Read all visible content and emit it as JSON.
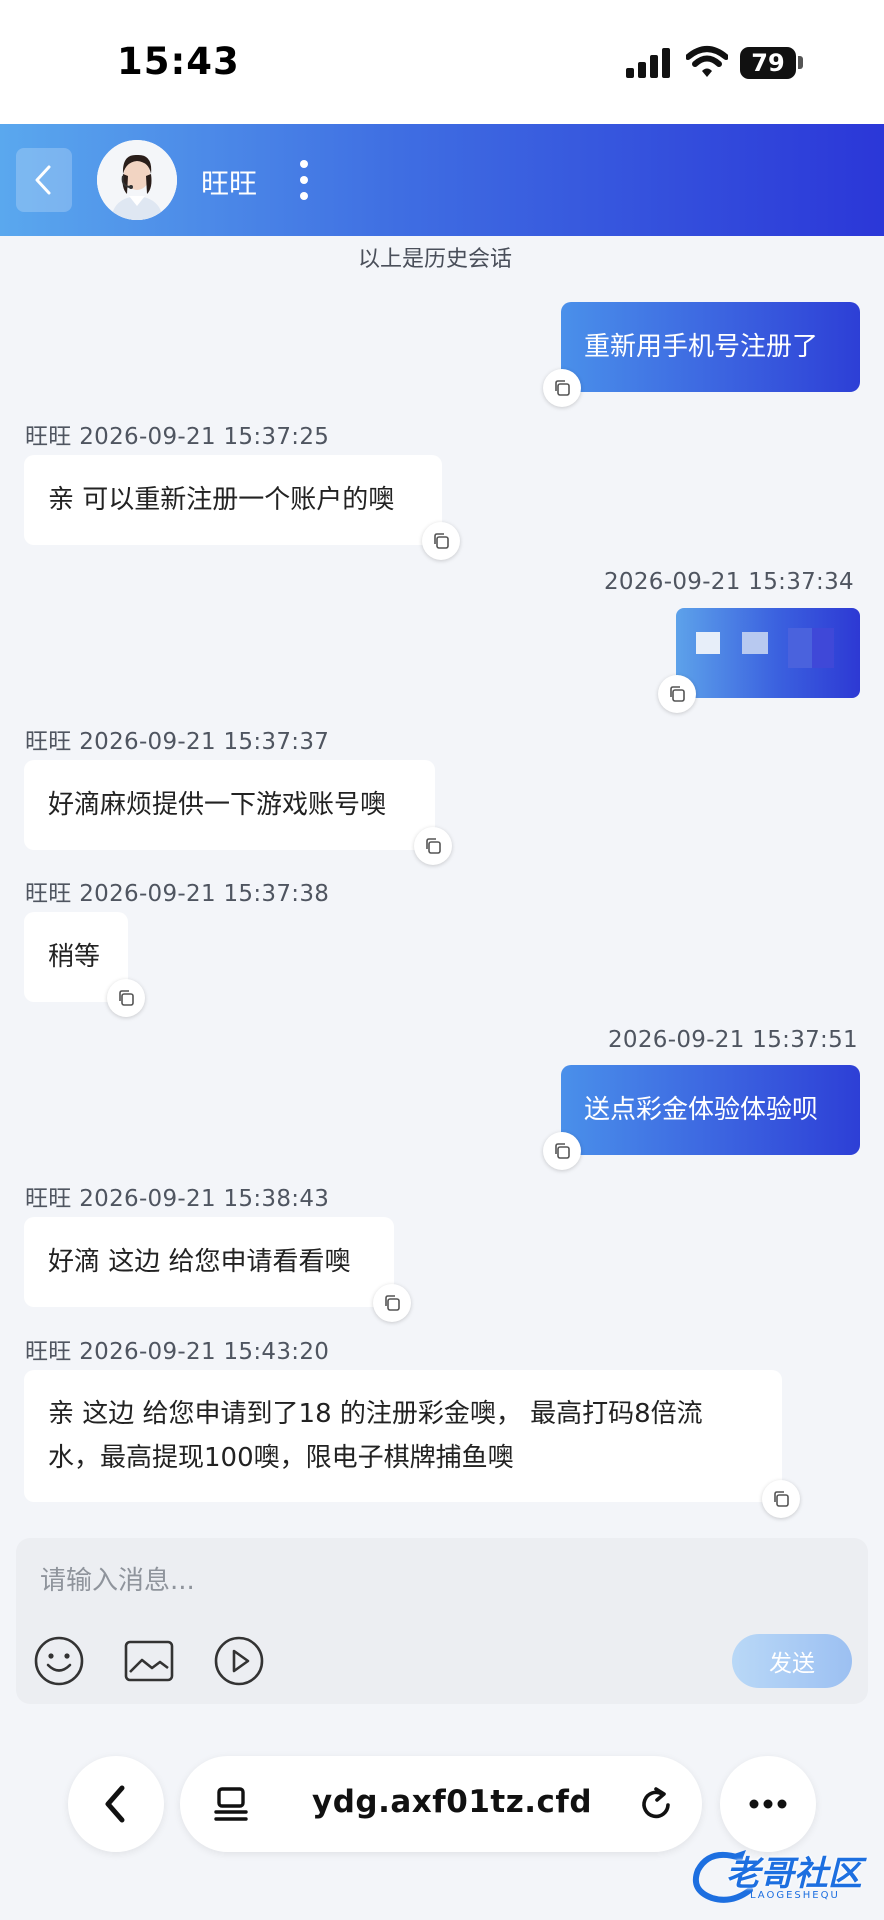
{
  "status_bar": {
    "time": "15:43",
    "battery": "79"
  },
  "header": {
    "agent_name": "旺旺"
  },
  "system_note": "以上是历史会话",
  "messages": [
    {
      "side": "out",
      "text": "重新用手机号注册了"
    },
    {
      "side": "in",
      "meta": "旺旺 2026-09-21 15:37:25",
      "text": "亲 可以重新注册一个账户的噢"
    },
    {
      "side": "out",
      "meta": "2026-09-21 15:37:34",
      "type": "image"
    },
    {
      "side": "in",
      "meta": "旺旺 2026-09-21 15:37:37",
      "text": "好滴麻烦提供一下游戏账号噢"
    },
    {
      "side": "in",
      "meta": "旺旺 2026-09-21 15:37:38",
      "text": "稍等"
    },
    {
      "side": "out",
      "meta": "2026-09-21 15:37:51",
      "text": "送点彩金体验体验呗"
    },
    {
      "side": "in",
      "meta": "旺旺 2026-09-21 15:38:43",
      "text": "好滴 这边 给您申请看看噢"
    },
    {
      "side": "in",
      "meta": "旺旺 2026-09-21 15:43:20",
      "text_lines": [
        "亲 这边 给您申请到了18 的注册彩金噢， 最高打码8倍流",
        "水，最高提现100噢，限电子棋牌捕鱼噢"
      ]
    }
  ],
  "composer": {
    "placeholder": "请输入消息...",
    "send_label": "发送"
  },
  "browser": {
    "url": "ydg.axf01tz.cfd"
  },
  "watermark": {
    "text": "老哥社区",
    "subtext": "LAOGESHEQU"
  },
  "colors": {
    "header_start": "#5aa8ee",
    "header_end": "#2b37d8",
    "outgoing_bubble": "#3a5fdf",
    "send_button": "#9cc0f2"
  }
}
